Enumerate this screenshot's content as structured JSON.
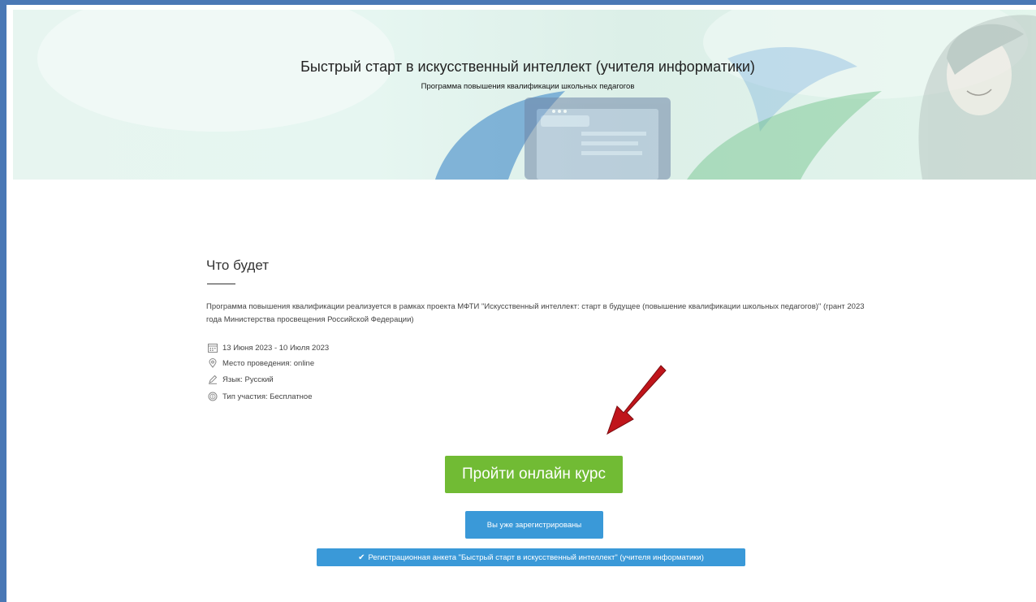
{
  "hero": {
    "title": "Быстрый старт в искусственный интеллект (учителя информатики)",
    "subtitle": "Программа повышения квалификации школьных педагогов"
  },
  "section": {
    "title": "Что будет",
    "description": "Программа повышения квалификации реализуется в рамках проекта МФТИ \"Искусственный интеллект: старт в будущее (повышение квалификации школьных педагогов)\" (грант 2023 года Министерства просвещения Российской Федерации)"
  },
  "info": {
    "dates": "13 Июня 2023 - 10 Июля 2023",
    "location": "Место проведения: online",
    "language": "Язык: Русский",
    "participation": "Тип участия: Бесплатное"
  },
  "icons": {
    "dates": "calendar-icon",
    "location": "location-pin-icon",
    "language": "pen-icon",
    "participation": "coin-icon",
    "form_button": "checkmark-icon",
    "annotation": "red-arrow-icon"
  },
  "buttons": {
    "take_course": "Пройти онлайн курс",
    "already_registered": "Вы уже зарегистрированы",
    "registration_form": "Регистрационная анкета \"Быстрый старт в искусственный интеллект\" (учителя информатики)"
  },
  "colors": {
    "frame_border": "#4a78b5",
    "primary_button": "#71bb34",
    "secondary_button": "#3a99d8",
    "arrow": "#c0151b"
  }
}
